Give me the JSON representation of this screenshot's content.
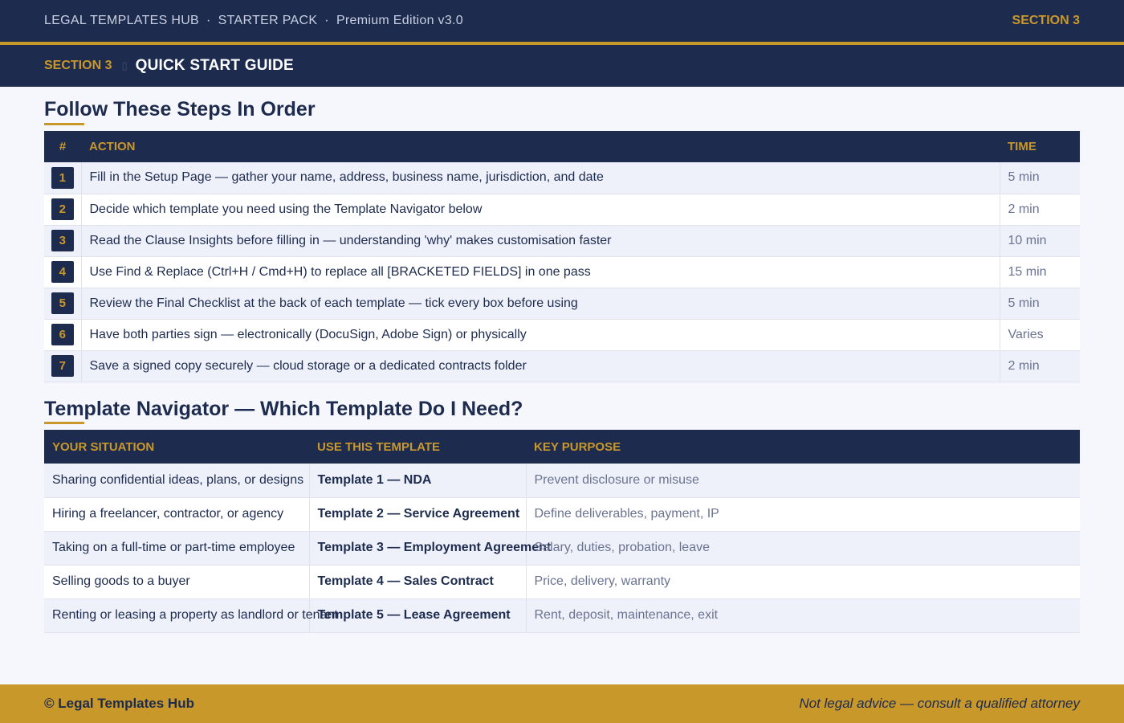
{
  "header": {
    "crumbs": [
      "LEGAL TEMPLATES HUB",
      "STARTER PACK",
      "Premium Edition v3.0"
    ],
    "separator": "·",
    "section_label": "SECTION 3"
  },
  "section_bar": {
    "number": "SECTION 3",
    "title": "QUICK START GUIDE"
  },
  "steps": {
    "heading": "Follow These Steps In Order",
    "columns": [
      "#",
      "ACTION",
      "TIME"
    ],
    "rows": [
      {
        "n": "1",
        "action": "Fill in the Setup Page — gather your name, address, business name, jurisdiction, and date",
        "time": "5 min"
      },
      {
        "n": "2",
        "action": "Decide which template you need using the Template Navigator below",
        "time": "2 min"
      },
      {
        "n": "3",
        "action": "Read the Clause Insights before filling in — understanding 'why' makes customisation faster",
        "time": "10 min"
      },
      {
        "n": "4",
        "action": "Use Find & Replace (Ctrl+H / Cmd+H) to replace all [BRACKETED FIELDS] in one pass",
        "time": "15 min"
      },
      {
        "n": "5",
        "action": "Review the Final Checklist at the back of each template — tick every box before using",
        "time": "5 min"
      },
      {
        "n": "6",
        "action": "Have both parties sign — electronically (DocuSign, Adobe Sign) or physically",
        "time": "Varies"
      },
      {
        "n": "7",
        "action": "Save a signed copy securely — cloud storage or a dedicated contracts folder",
        "time": "2 min"
      }
    ]
  },
  "navigator": {
    "heading": "Template Navigator — Which Template Do I Need?",
    "columns": [
      "YOUR SITUATION",
      "USE THIS TEMPLATE",
      "KEY PURPOSE"
    ],
    "rows": [
      {
        "situation": "Sharing confidential ideas, plans, or designs",
        "template": "Template 1 — NDA",
        "purpose": "Prevent disclosure or misuse"
      },
      {
        "situation": "Hiring a freelancer, contractor, or agency",
        "template": "Template 2 — Service Agreement",
        "purpose": "Define deliverables, payment, IP"
      },
      {
        "situation": "Taking on a full-time or part-time employee",
        "template": "Template 3 — Employment Agreement",
        "purpose": "Salary, duties, probation, leave"
      },
      {
        "situation": "Selling goods to a buyer",
        "template": "Template 4 — Sales Contract",
        "purpose": "Price, delivery, warranty"
      },
      {
        "situation": "Renting or leasing a property as landlord or tenant",
        "template": "Template 5 — Lease Agreement",
        "purpose": "Rent, deposit, maintenance, exit"
      }
    ]
  },
  "footer": {
    "brand": "© Legal Templates Hub",
    "note": "Not legal advice — consult a qualified attorney"
  },
  "colors": {
    "navy": "#1d2b4f",
    "gold": "#c9982a"
  }
}
